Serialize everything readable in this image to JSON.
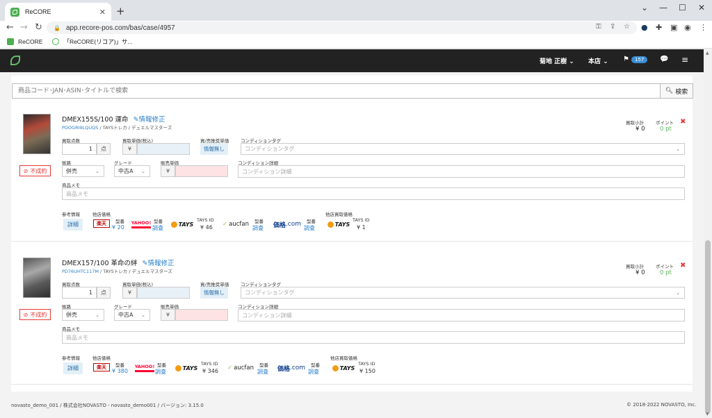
{
  "browser": {
    "tab_title": "ReCORE",
    "url": "app.recore-pos.com/bas/case/4957",
    "bookmarks": [
      "ReCORE",
      "「ReCORE(リコア)」サ..."
    ]
  },
  "navbar": {
    "user": "菊地 正樹",
    "store": "本店",
    "flag_count": "157"
  },
  "search": {
    "placeholder": "商品コード･JAN･ASIN･タイトルで検索",
    "button_label": "検索"
  },
  "labels": {
    "buy_count": "買取点数",
    "unit": "点",
    "buy_price": "買取単価(税込)",
    "buy_sell_rec": "買/売推奨単価",
    "condition_tag": "コンディションタグ",
    "route": "販路",
    "grade": "グレード",
    "sell_price": "販売単価",
    "condition_detail": "コンディション詳細",
    "memo": "商品メモ",
    "ref": "参考情報",
    "other_price": "他店価格",
    "other_buy_price": "他店買取価格",
    "subtotal": "買取小計",
    "points": "ポイント",
    "yen": "¥",
    "status": "不成約",
    "edit": "情報修正",
    "no_info": "情報無し",
    "detail": "詳細",
    "kata_ban": "型番",
    "survey": "調査",
    "tays_id": "TAYS ID"
  },
  "placeholders": {
    "condition_tag": "コンディションタグ",
    "condition_detail": "コンディション詳細",
    "memo": "商品メモ"
  },
  "logos": {
    "rakuten": "楽天",
    "yahoo": "YAHOO!",
    "tays": "TAYS",
    "aucfan": "aucfan",
    "kakaku": "価格",
    "kakaku_com": ".com"
  },
  "items": [
    {
      "title": "DMEX155S/100 運命",
      "code": "PDOGRI9LQUQS",
      "category": " / TAYSトレカ / デュエルマスターズ",
      "count": "1",
      "route": "併売",
      "grade": "中古A",
      "subtotal": "¥ 0",
      "points": "0 pt",
      "rakuten_price": "¥ 20",
      "tays_price": "¥ 46",
      "tays_buy_price": "¥ 1"
    },
    {
      "title": "DMEX157/100 革命の絆",
      "code": "PD76UHTC117M",
      "category": " / TAYSトレカ / デュエルマスターズ",
      "count": "1",
      "route": "併売",
      "grade": "中古A",
      "subtotal": "¥ 0",
      "points": "0 pt",
      "rakuten_price": "¥ 380",
      "tays_price": "¥ 346",
      "tays_buy_price": "¥ 150"
    }
  ],
  "footer": {
    "left": "novasto_demo_001 / 株式会社NOVASTO - novasto_demo001 / バージョン: 3.15.0",
    "right": "© 2018-2022 NOVASTO, Inc."
  }
}
